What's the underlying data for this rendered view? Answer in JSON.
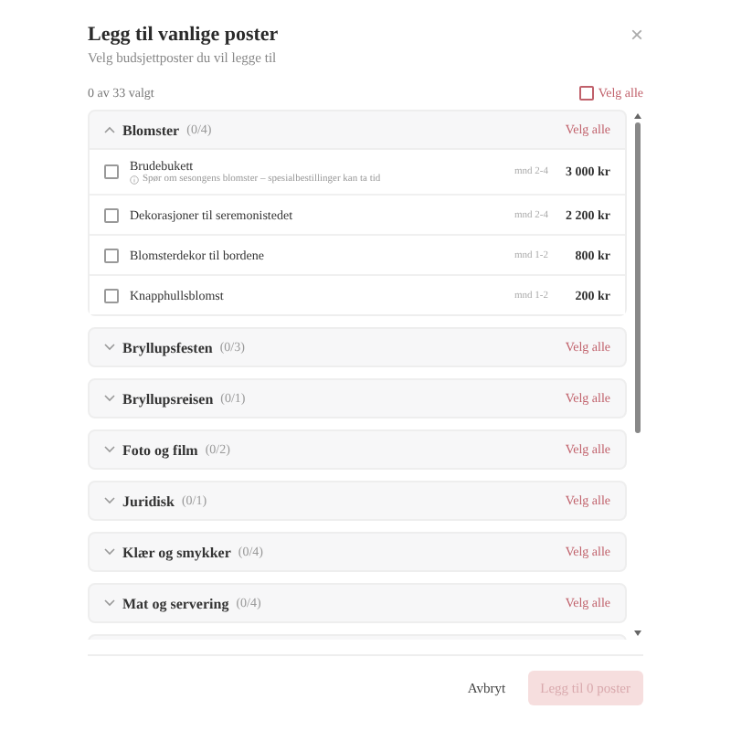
{
  "dialog": {
    "title": "Legg til vanlige poster",
    "subtitle": "Velg budsjettposter du vil legge til",
    "close": "×"
  },
  "selection": {
    "count": "0 av 33 valgt",
    "select_all": "Velg alle",
    "checked": false
  },
  "groups": [
    {
      "name": "Blomster",
      "count": "(0/4)",
      "expanded": true,
      "select_all": "Velg alle",
      "items": [
        {
          "name": "Brudebukett",
          "note": "Spør om sesongens blomster – spesialbestillinger kan ta tid",
          "timing": "mnd 2-4",
          "price": "3 000 kr",
          "checked": false
        },
        {
          "name": "Dekorasjoner til seremonistedet",
          "timing": "mnd 2-4",
          "price": "2 200 kr",
          "checked": false
        },
        {
          "name": "Blomsterdekor til bordene",
          "timing": "mnd 1-2",
          "price": "800 kr",
          "checked": false
        },
        {
          "name": "Knapphullsblomst",
          "timing": "mnd 1-2",
          "price": "200 kr",
          "checked": false
        }
      ]
    },
    {
      "name": "Bryllupsfesten",
      "count": "(0/3)",
      "expanded": false,
      "select_all": "Velg alle"
    },
    {
      "name": "Bryllupsreisen",
      "count": "(0/1)",
      "expanded": false,
      "select_all": "Velg alle"
    },
    {
      "name": "Foto og film",
      "count": "(0/2)",
      "expanded": false,
      "select_all": "Velg alle"
    },
    {
      "name": "Juridisk",
      "count": "(0/1)",
      "expanded": false,
      "select_all": "Velg alle"
    },
    {
      "name": "Klær og smykker",
      "count": "(0/4)",
      "expanded": false,
      "select_all": "Velg alle"
    },
    {
      "name": "Mat og servering",
      "count": "(0/4)",
      "expanded": false,
      "select_all": "Velg alle"
    }
  ],
  "footer": {
    "cancel": "Avbryt",
    "submit": "Legg til 0 poster",
    "submit_disabled": true
  }
}
